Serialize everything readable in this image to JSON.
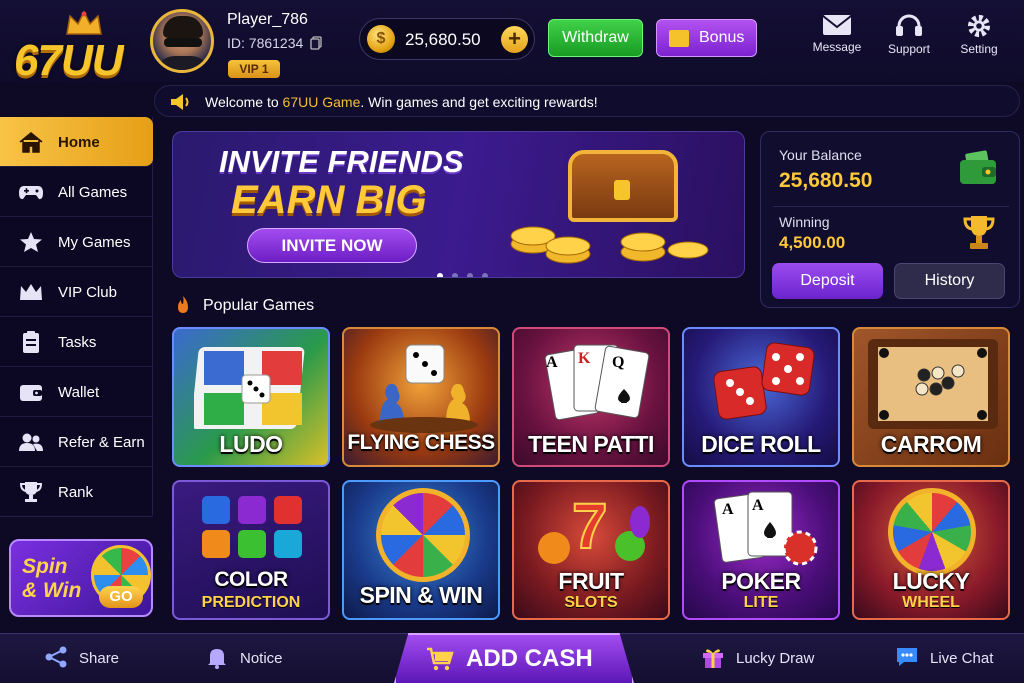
{
  "brand": {
    "logo": "67UU"
  },
  "player": {
    "name": "Player_786",
    "id": "ID: 7861234",
    "vip": "VIP 1"
  },
  "wallet_top": {
    "coins": "25,680.50"
  },
  "top_buttons": {
    "withdraw": "Withdraw",
    "bonus": "Bonus"
  },
  "top_icons": {
    "message": "Message",
    "support": "Support",
    "setting": "Setting"
  },
  "welcome": {
    "prefix": "Welcome to ",
    "brand": "67UU Game",
    "suffix": ". Win games and get exciting rewards!"
  },
  "sidebar": {
    "items": [
      {
        "label": "Home",
        "icon": "home-icon"
      },
      {
        "label": "All Games",
        "icon": "gamepad-icon"
      },
      {
        "label": "My Games",
        "icon": "star-icon"
      },
      {
        "label": "VIP Club",
        "icon": "crown-icon"
      },
      {
        "label": "Tasks",
        "icon": "clipboard-icon"
      },
      {
        "label": "Wallet",
        "icon": "wallet-icon"
      },
      {
        "label": "Refer & Earn",
        "icon": "users-icon"
      },
      {
        "label": "Rank",
        "icon": "trophy-icon"
      }
    ]
  },
  "spin_promo": {
    "line1": "Spin",
    "line2": "& Win",
    "go": "GO"
  },
  "banner": {
    "line1": "INVITE FRIENDS",
    "line2": "EARN BIG",
    "cta": "INVITE NOW"
  },
  "balance": {
    "label": "Your Balance",
    "value": "25,680.50",
    "winning_label": "Winning",
    "winning_value": "4,500.00",
    "deposit": "Deposit",
    "history": "History"
  },
  "section": {
    "popular": "Popular Games"
  },
  "games": [
    {
      "name": "LUDO",
      "sub": ""
    },
    {
      "name": "FLYING CHESS",
      "sub": ""
    },
    {
      "name": "TEEN PATTI",
      "sub": ""
    },
    {
      "name": "DICE ROLL",
      "sub": ""
    },
    {
      "name": "CARROM",
      "sub": ""
    },
    {
      "name": "COLOR",
      "sub": "PREDICTION"
    },
    {
      "name": "SPIN & WIN",
      "sub": ""
    },
    {
      "name": "FRUIT",
      "sub": "SLOTS"
    },
    {
      "name": "POKER",
      "sub": "LITE"
    },
    {
      "name": "LUCKY",
      "sub": "WHEEL"
    }
  ],
  "bottom_nav": {
    "share": "Share",
    "notice": "Notice",
    "add_cash": "ADD CASH",
    "lucky_draw": "Lucky Draw",
    "live_chat": "Live Chat"
  },
  "colors": {
    "accent_gold": "#f6c52c",
    "accent_purple": "#8a36e0",
    "bg": "#0e0a26",
    "green": "#2bb734"
  }
}
